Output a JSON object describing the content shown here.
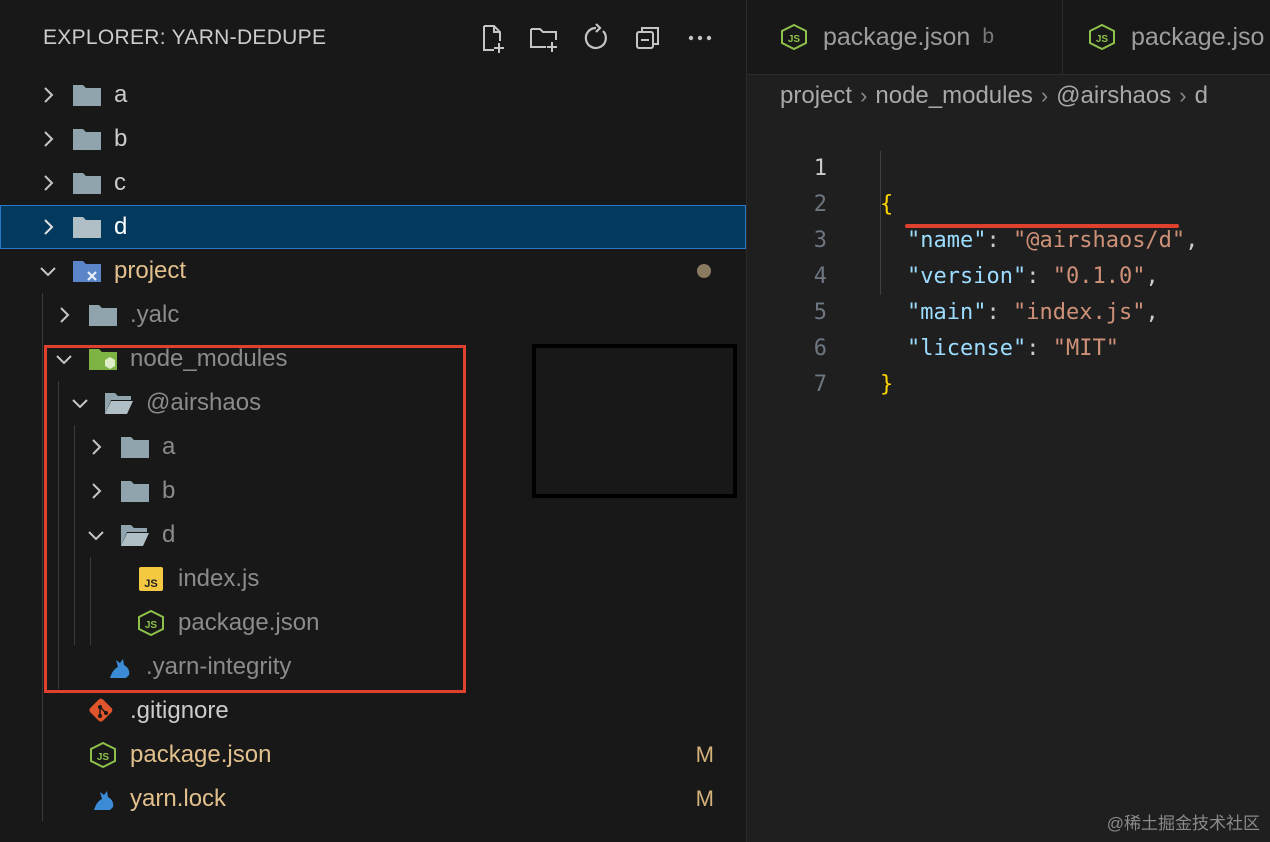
{
  "explorer": {
    "title": "EXPLORER: YARN-DEDUPE",
    "actions": [
      {
        "name": "new-file-icon"
      },
      {
        "name": "new-folder-icon"
      },
      {
        "name": "refresh-icon"
      },
      {
        "name": "collapse-all-icon"
      },
      {
        "name": "more-actions-icon"
      }
    ],
    "tree": {
      "a": "a",
      "b": "b",
      "c": "c",
      "d": "d",
      "project": "project",
      "yalc": ".yalc",
      "node_modules": "node_modules",
      "airshaos": "@airshaos",
      "nm_a": "a",
      "nm_b": "b",
      "nm_d": "d",
      "index_js": "index.js",
      "nm_package_json": "package.json",
      "yarn_integrity": ".yarn-integrity",
      "gitignore": ".gitignore",
      "package_json": "package.json",
      "yarn_lock": "yarn.lock"
    },
    "badges": {
      "package_json": "M",
      "yarn_lock": "M"
    }
  },
  "editor": {
    "tabs": [
      {
        "label": "package.json",
        "description": "b"
      },
      {
        "label": "package.jso",
        "description": ""
      }
    ],
    "breadcrumb": [
      "project",
      "node_modules",
      "@airshaos",
      "d"
    ],
    "lines": [
      "1",
      "2",
      "3",
      "4",
      "5",
      "6",
      "7"
    ],
    "code": {
      "open_brace": "{",
      "close_brace": "}",
      "name_key": "\"name\"",
      "name_val": "\"@airshaos/d\"",
      "version_key": "\"version\"",
      "version_val": "\"0.1.0\"",
      "main_key": "\"main\"",
      "main_val": "\"index.js\"",
      "license_key": "\"license\"",
      "license_val": "\"MIT\"",
      "colon": ": ",
      "comma": ","
    }
  },
  "watermark": "@稀土掘金技术社区",
  "colors": {
    "accent_selection": "#04395e",
    "highlight_red": "#e0412e",
    "modified_badge": "#d4b07a",
    "json_icon": "#8dc149",
    "js_icon": "#f5c842",
    "yarn_icon": "#3b8bd6",
    "git_icon": "#e0552c"
  }
}
